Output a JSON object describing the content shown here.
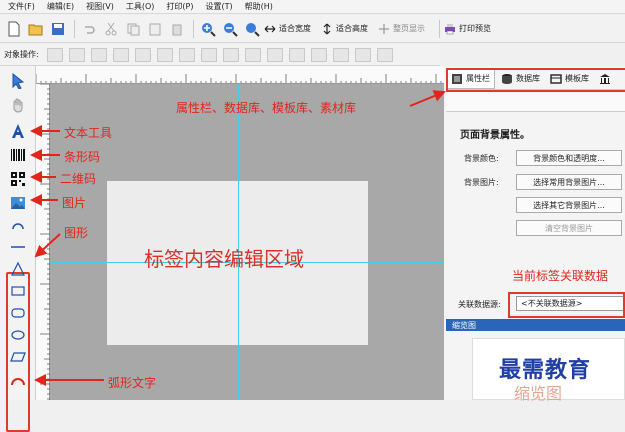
{
  "menu": [
    "文件(F)",
    "编辑(E)",
    "视图(V)",
    "工具(O)",
    "打印(P)",
    "设置(T)",
    "帮助(H)"
  ],
  "toolbar": {
    "fit_width": "适合宽度",
    "fit_height": "适合高度",
    "full_page": "整页显示",
    "print_preview": "打印预览"
  },
  "toolbar2": {
    "label": "对象操作:"
  },
  "right_panel": {
    "tabs": [
      "属性栏",
      "数据库",
      "模板库"
    ],
    "section_title": "页面背景属性。",
    "bg_color_label": "背景颜色:",
    "bg_color_button": "背景颜色和透明度...",
    "bg_image_label": "背景图片:",
    "bg_common_button": "选择常用背景图片...",
    "bg_other_button": "选择其它背景图片...",
    "clear_bg_button": "清空背景图片",
    "datasource_label": "关联数据源:",
    "datasource_value": "<不关联数据源>",
    "thumbnail_header": "缩览图"
  },
  "canvas": {
    "area_label": "标签内容编辑区域"
  },
  "annotations": {
    "panels": "属性栏、数据库、模板库、素材库",
    "text_tool": "文本工具",
    "barcode": "条形码",
    "qrcode": "二维码",
    "image": "图片",
    "shape": "图形",
    "arc_text": "弧形文字",
    "datasource_note": "当前标签关联数据",
    "thumbnail_big": "缩览图"
  },
  "watermark": "最需教育",
  "colors": {
    "annotation": "#e0251c",
    "guide": "#3fd0e6",
    "canvas": "#a8a8a8"
  }
}
